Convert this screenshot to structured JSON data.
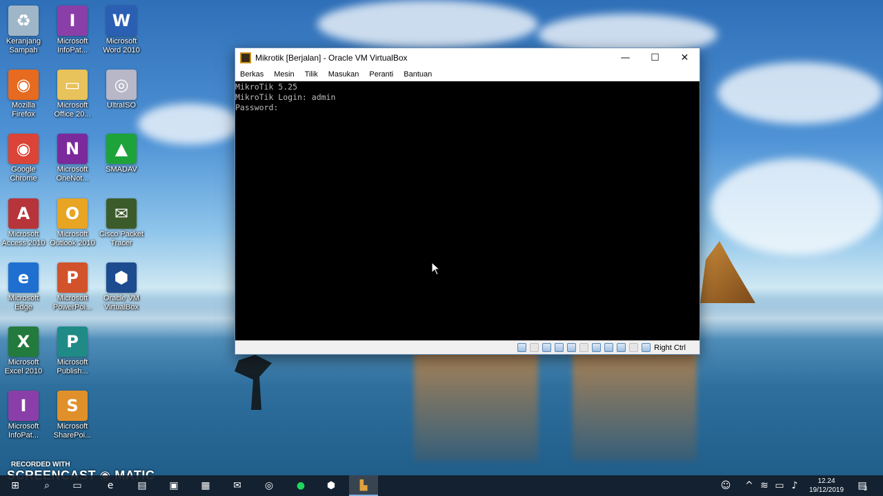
{
  "desktop": {
    "icons": [
      {
        "label": "Keranjang\nSampah",
        "icon": "recycle-bin-icon",
        "color": "#9fb6c8",
        "glyph": "♻"
      },
      {
        "label": "Microsoft\nInfoPat...",
        "icon": "infopath-icon",
        "color": "#8a3fa8",
        "glyph": "I"
      },
      {
        "label": "Microsoft\nWord 2010",
        "icon": "word-icon",
        "color": "#2b5fb3",
        "glyph": "W"
      },
      {
        "label": "Mozilla\nFirefox",
        "icon": "firefox-icon",
        "color": "#e66a1f",
        "glyph": "◉"
      },
      {
        "label": "Microsoft\nOffice 20...",
        "icon": "office-folder-icon",
        "color": "#e8c25a",
        "glyph": "▭"
      },
      {
        "label": "UltraISO",
        "icon": "ultraiso-icon",
        "color": "#b7b7c7",
        "glyph": "◎"
      },
      {
        "label": "Google\nChrome",
        "icon": "chrome-icon",
        "color": "#db4437",
        "glyph": "◉"
      },
      {
        "label": "Microsoft\nOneNot...",
        "icon": "onenote-icon",
        "color": "#7b2a9c",
        "glyph": "N"
      },
      {
        "label": "SMADAV",
        "icon": "smadav-icon",
        "color": "#1ea33a",
        "glyph": "▲"
      },
      {
        "label": "Microsoft\nAccess 2010",
        "icon": "access-icon",
        "color": "#b7343a",
        "glyph": "A"
      },
      {
        "label": "Microsoft\nOutlook 2010",
        "icon": "outlook-icon",
        "color": "#e8a423",
        "glyph": "O"
      },
      {
        "label": "Cisco Packet\nTracer",
        "icon": "packet-tracer-icon",
        "color": "#3c5b2a",
        "glyph": "✉"
      },
      {
        "label": "Microsoft\nEdge",
        "icon": "edge-icon",
        "color": "#1f6fd1",
        "glyph": "e"
      },
      {
        "label": "Microsoft\nPowerPoi...",
        "icon": "powerpoint-icon",
        "color": "#d2532b",
        "glyph": "P"
      },
      {
        "label": "Oracle VM\nVirtualBox",
        "icon": "virtualbox-icon",
        "color": "#1d4b8f",
        "glyph": "⬢"
      },
      {
        "label": "Microsoft\nExcel 2010",
        "icon": "excel-icon",
        "color": "#227a3c",
        "glyph": "X"
      },
      {
        "label": "Microsoft\nPublish...",
        "icon": "publisher-icon",
        "color": "#1f8a86",
        "glyph": "P"
      },
      {
        "label": "Microsoft\nInfoPat...",
        "icon": "infopath-icon",
        "color": "#8a3fa8",
        "glyph": "I"
      },
      {
        "label": "Microsoft\nSharePoi...",
        "icon": "sharepoint-icon",
        "color": "#e0902a",
        "glyph": "S"
      }
    ]
  },
  "window": {
    "title": "Mikrotik [Berjalan] - Oracle VM VirtualBox",
    "minimize": "—",
    "maximize": "☐",
    "close": "✕",
    "menu": [
      "Berkas",
      "Mesin",
      "Tilik",
      "Masukan",
      "Peranti",
      "Bantuan"
    ],
    "console_lines": [
      "MikroTik 5.25",
      "MikroTik Login: admin",
      "Password:"
    ],
    "host_key": "Right Ctrl"
  },
  "watermark": {
    "line1": "RECORDED WITH",
    "line2": "SCREENCAST",
    "line3": "MATIC"
  },
  "taskbar": {
    "time": "12.24",
    "date": "19/12/2019",
    "notification_count": "3"
  }
}
